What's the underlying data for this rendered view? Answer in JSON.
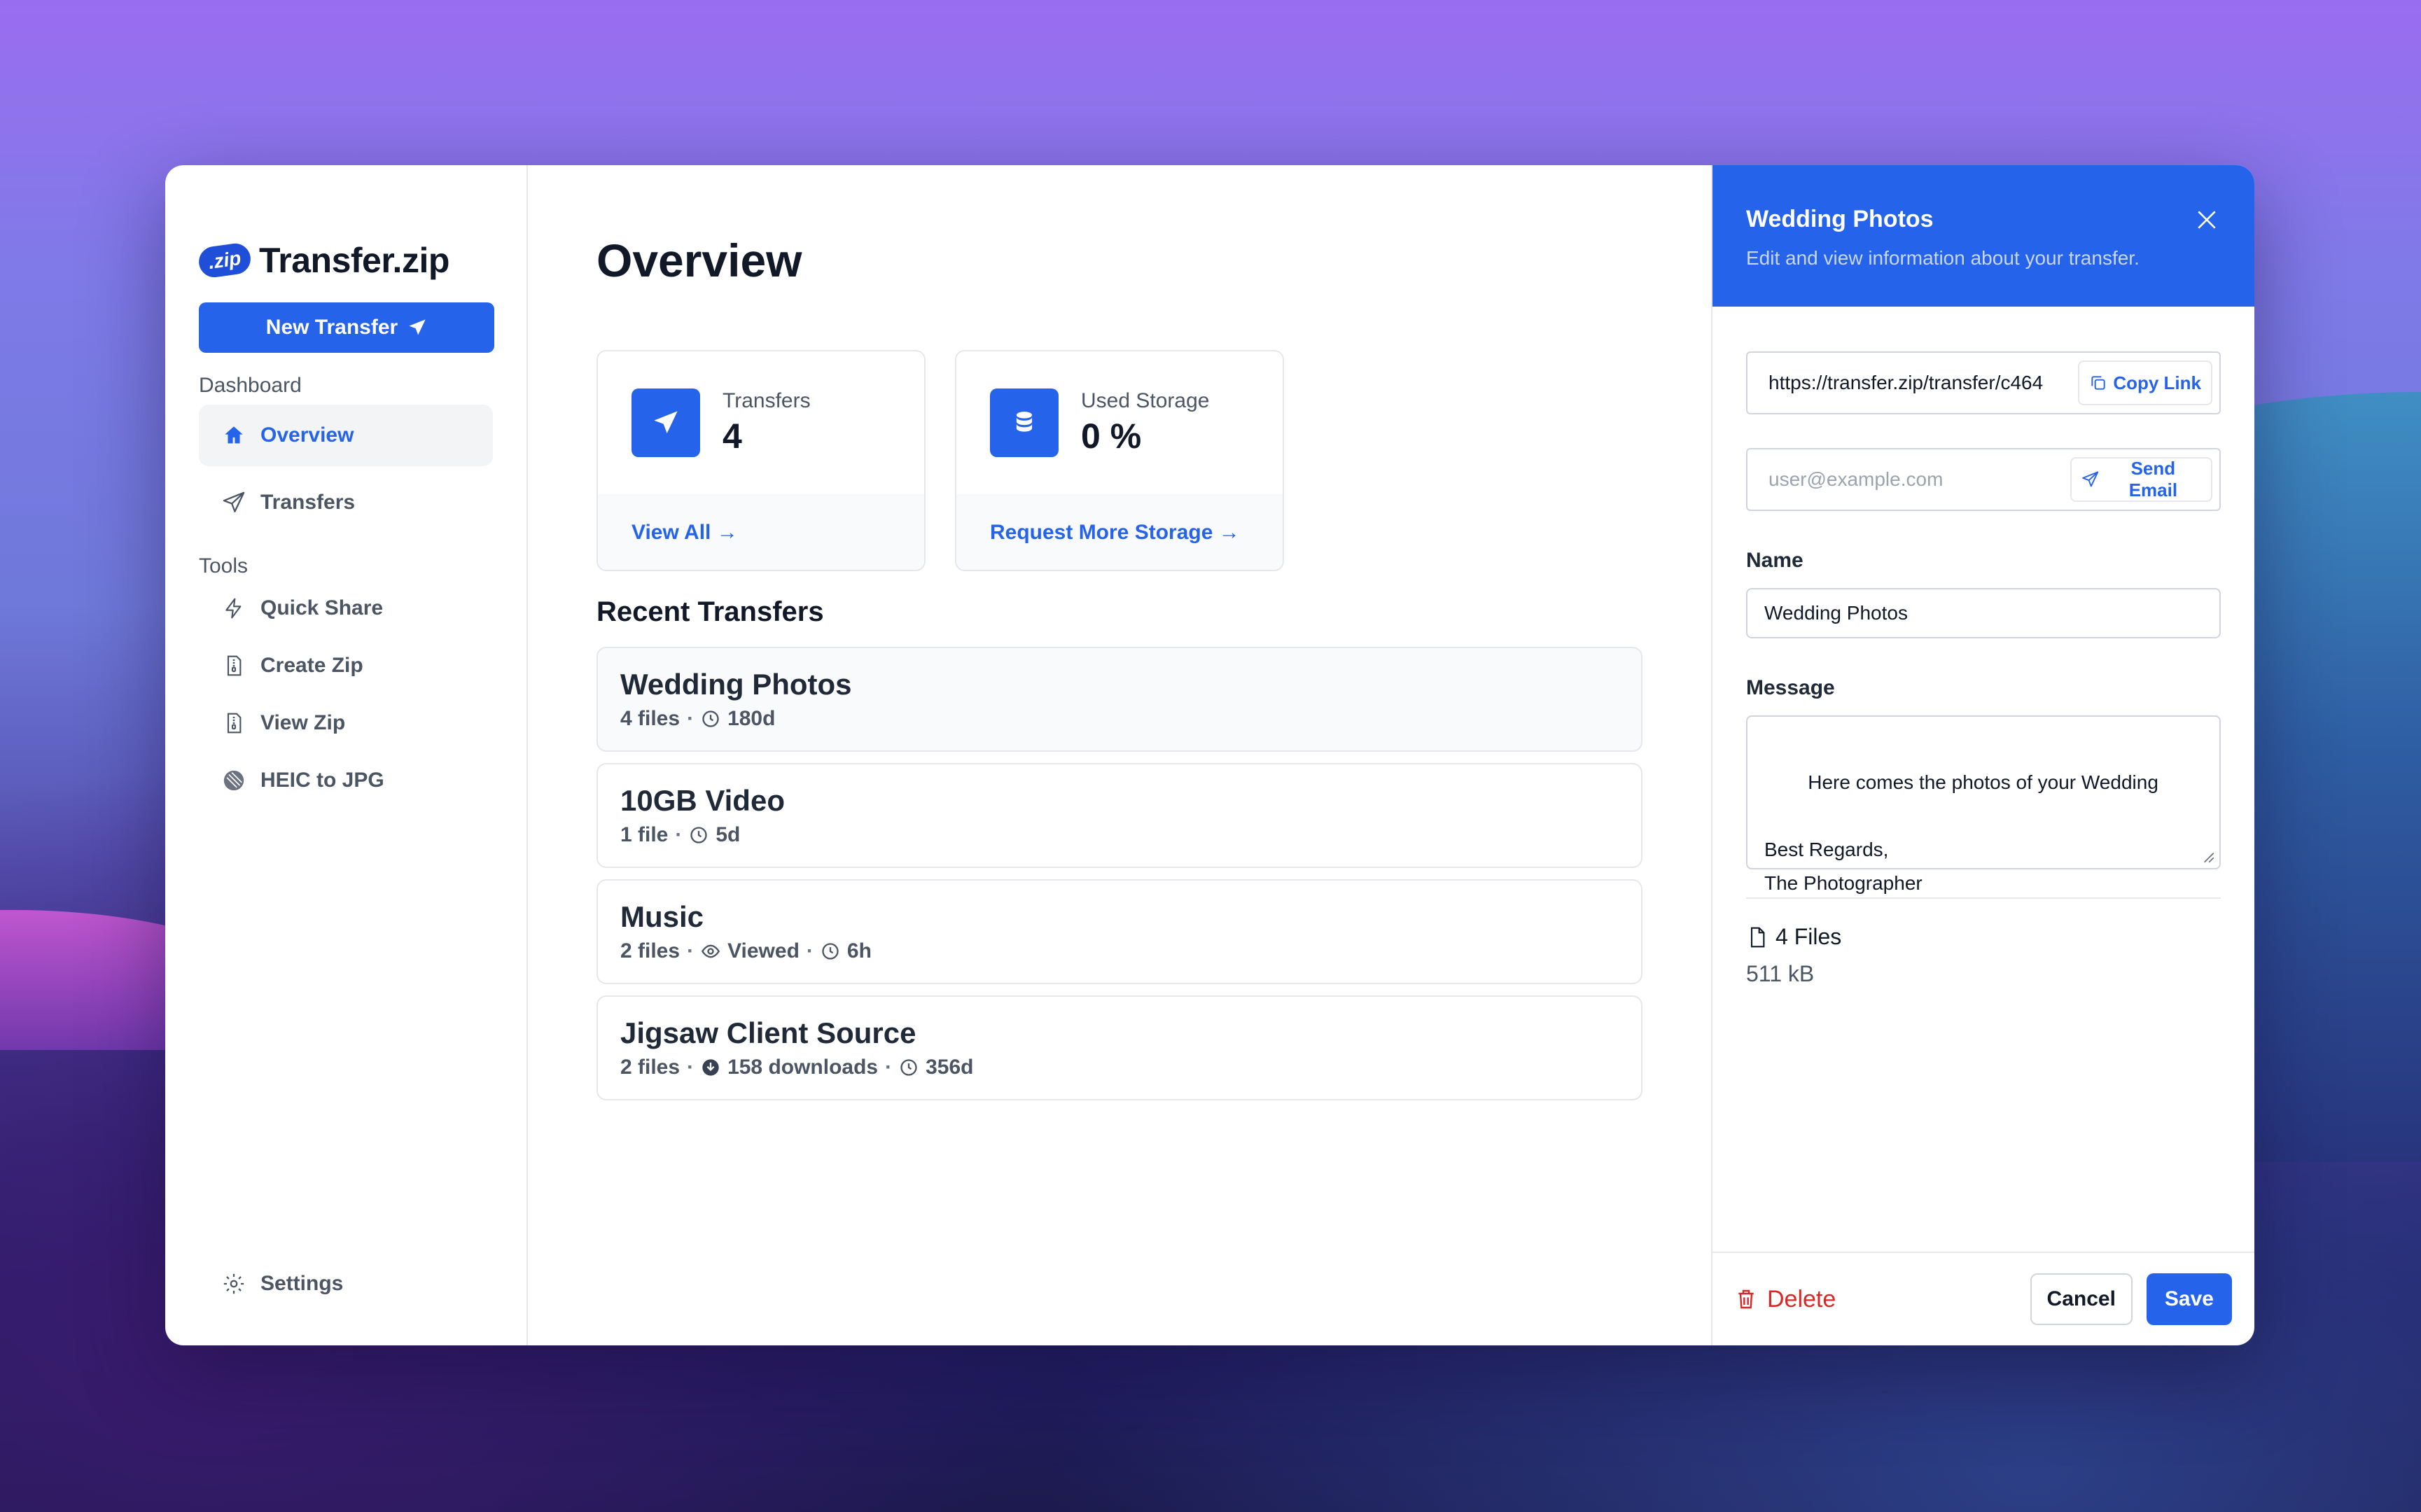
{
  "app": {
    "logo_badge": ".zip",
    "name": "Transfer.zip"
  },
  "sidebar": {
    "new_transfer_label": "New Transfer",
    "dashboard_label": "Dashboard",
    "nav": [
      {
        "label": "Overview",
        "icon": "home-icon"
      },
      {
        "label": "Transfers",
        "icon": "paper-plane-icon"
      }
    ],
    "tools_label": "Tools",
    "tools": [
      {
        "label": "Quick Share",
        "icon": "lightning-icon"
      },
      {
        "label": "Create Zip",
        "icon": "zip-file-icon"
      },
      {
        "label": "View Zip",
        "icon": "zip-file-icon"
      },
      {
        "label": "HEIC to JPG",
        "icon": "image-convert-icon"
      }
    ],
    "settings_label": "Settings"
  },
  "main": {
    "title": "Overview",
    "stats": [
      {
        "label": "Transfers",
        "value": "4",
        "link": "View All →",
        "icon": "paper-plane-icon"
      },
      {
        "label": "Used Storage",
        "value": "0 %",
        "link": "Request More Storage →",
        "icon": "database-icon"
      }
    ],
    "recent_title": "Recent Transfers",
    "transfers": [
      {
        "name": "Wedding Photos",
        "files": "4 files",
        "viewed": "",
        "downloads": "",
        "expires": "180d"
      },
      {
        "name": "10GB Video",
        "files": "1 file",
        "viewed": "",
        "downloads": "",
        "expires": "5d"
      },
      {
        "name": "Music",
        "files": "2 files",
        "viewed": "Viewed",
        "downloads": "",
        "expires": "6h"
      },
      {
        "name": "Jigsaw Client Source",
        "files": "2 files",
        "viewed": "",
        "downloads": "158 downloads",
        "expires": "356d"
      }
    ]
  },
  "panel": {
    "title": "Wedding Photos",
    "subtitle": "Edit and view information about your transfer.",
    "link_value": "https://transfer.zip/transfer/c464",
    "copy_link_label": "Copy Link",
    "email_placeholder": "user@example.com",
    "send_email_label": "Send Email",
    "name_label": "Name",
    "name_value": "Wedding Photos",
    "message_label": "Message",
    "message_value": "Here comes the photos of your Wedding\n\nBest Regards,\nThe Photographer",
    "files_count": "4 Files",
    "files_size": "511 kB",
    "delete_label": "Delete",
    "cancel_label": "Cancel",
    "save_label": "Save"
  },
  "colors": {
    "accent": "#2563eb",
    "danger": "#dc2626"
  }
}
